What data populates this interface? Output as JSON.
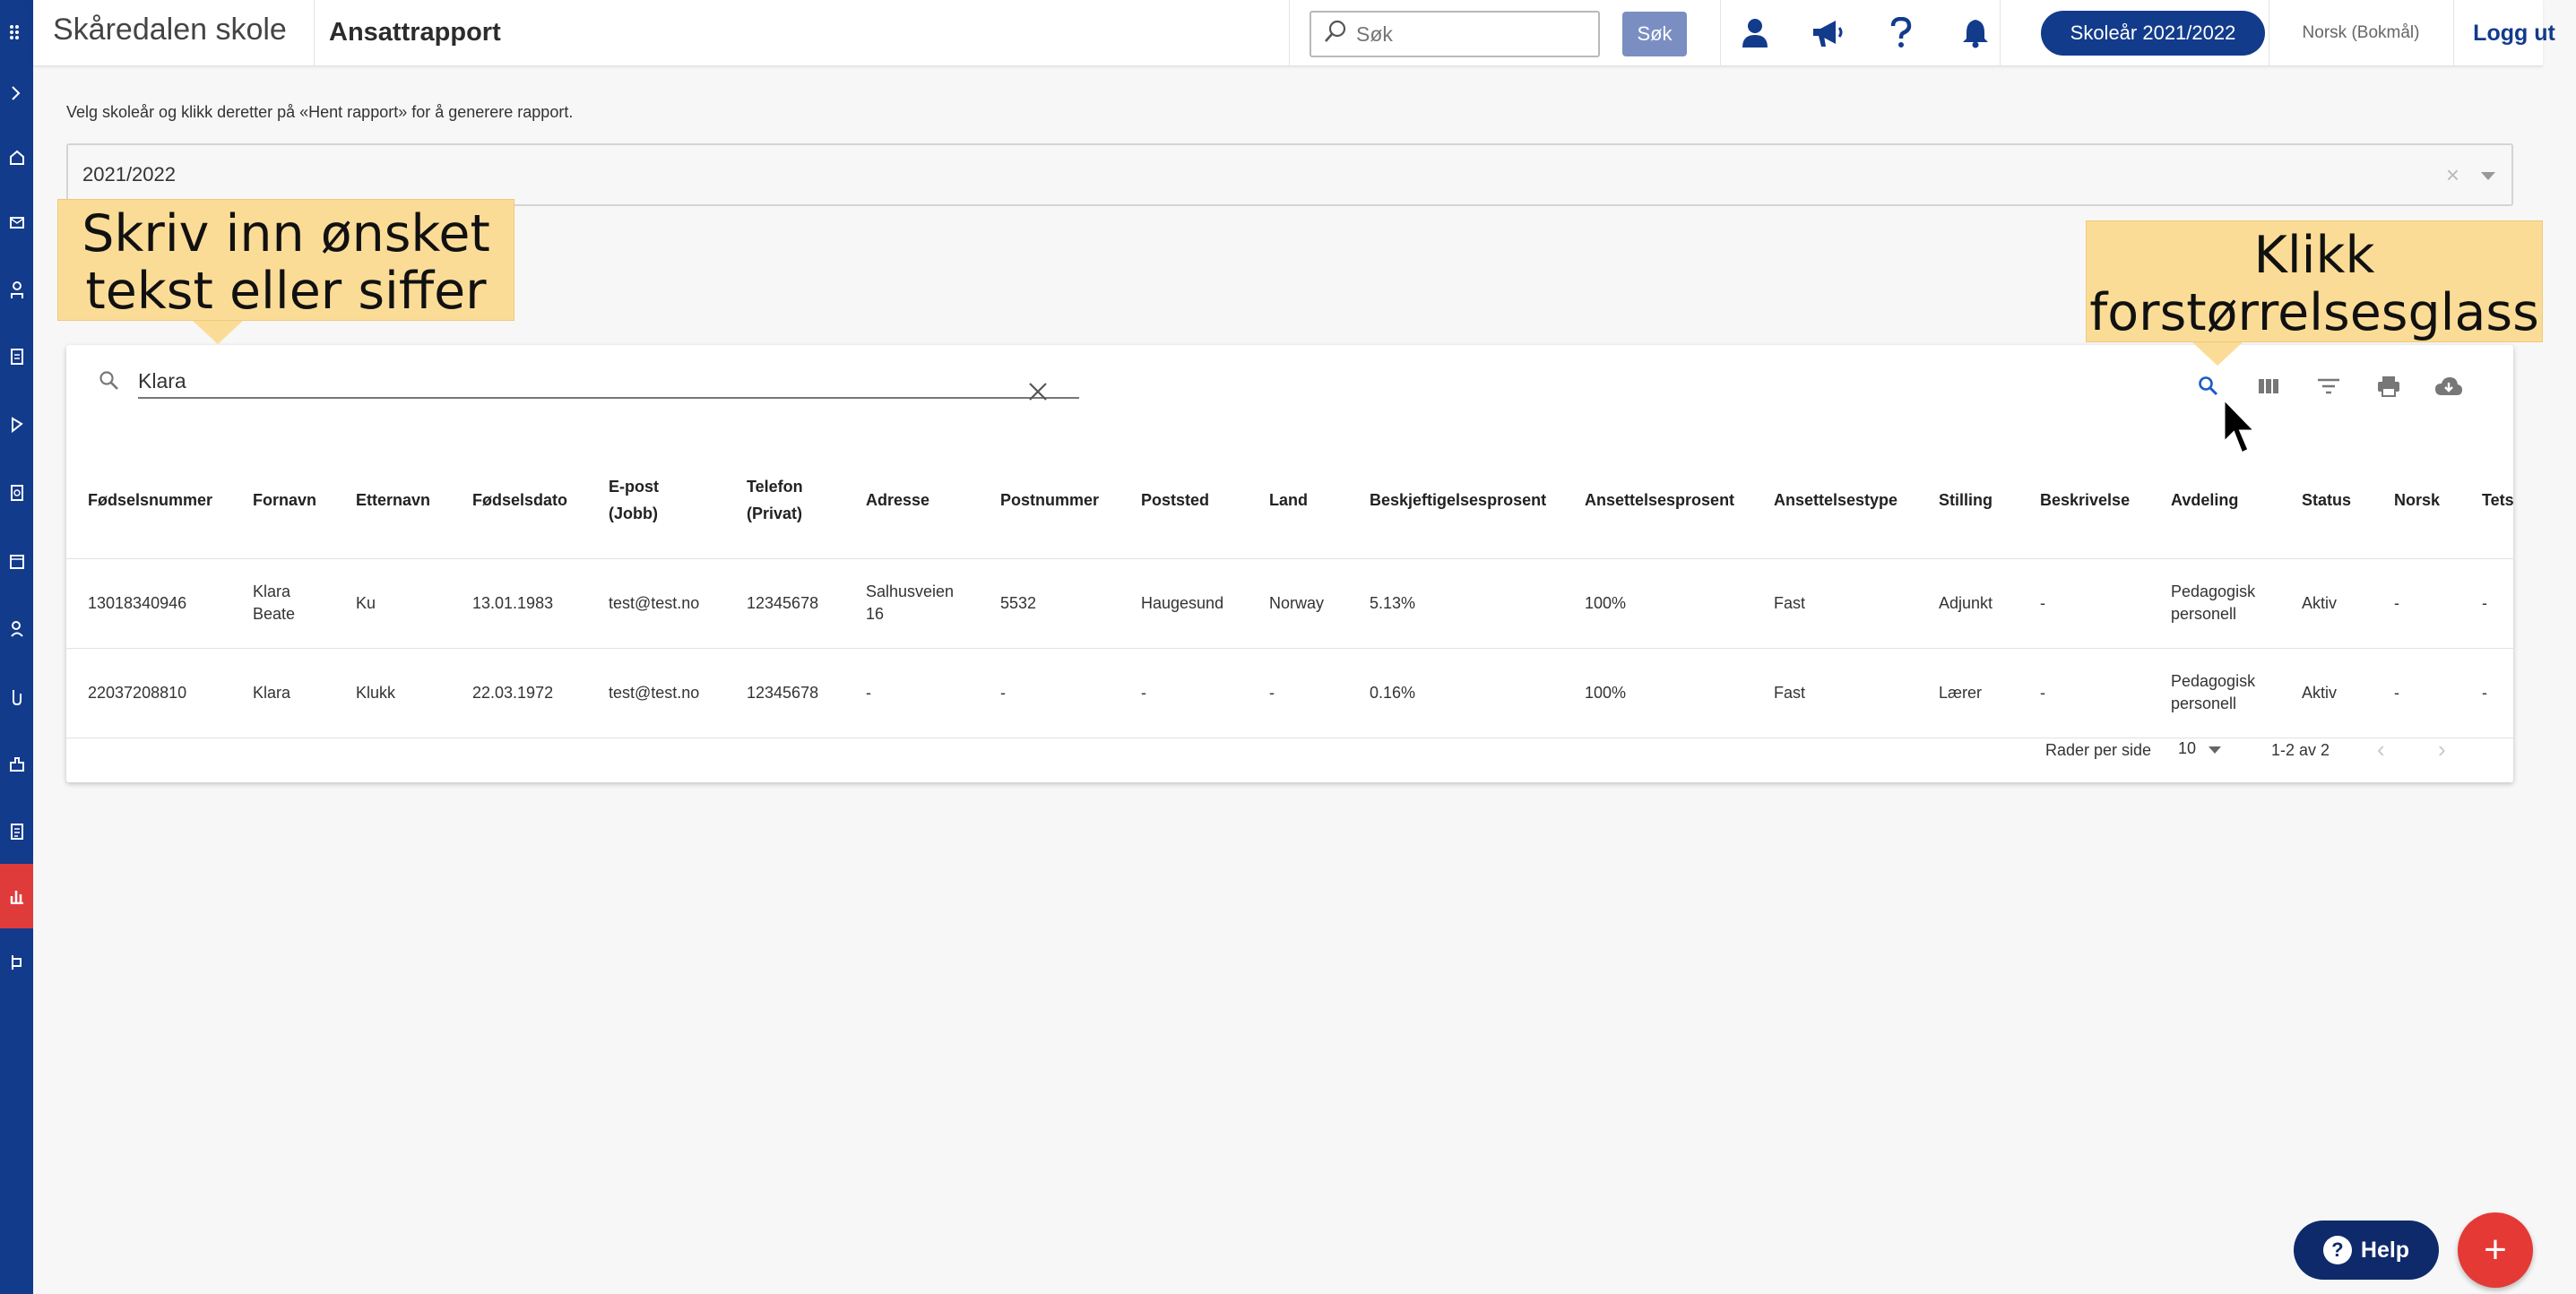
{
  "header": {
    "school_name": "Skåredalen skole",
    "page_title": "Ansattrapport",
    "search_placeholder": "Søk",
    "search_button": "Søk",
    "school_year_button": "Skoleår 2021/2022",
    "language": "Norsk (Bokmål)",
    "logout": "Logg ut",
    "icons": [
      "user-icon",
      "megaphone-icon",
      "help-icon",
      "bell-icon"
    ]
  },
  "sidebar": {
    "icons": [
      "apps-icon",
      "chevron-right-icon",
      "home-icon",
      "mail-icon",
      "students-icon",
      "document-icon",
      "timetable-icon",
      "assessment-icon",
      "calendar-icon",
      "users-icon",
      "absence-icon",
      "school-icon",
      "reports-icon",
      "statistics-icon",
      "settings-icon"
    ],
    "active": "statistics-icon",
    "active_color": "#e03b3b",
    "color": "#123b8c"
  },
  "content": {
    "instruction": "Velg skoleår og klikk deretter på «Hent rapport» for å generere rapport.",
    "selected_year": "2021/2022"
  },
  "table": {
    "search_value": "Klara",
    "columns": [
      {
        "line1": "Fødselsnummer",
        "line2": ""
      },
      {
        "line1": "Fornavn",
        "line2": ""
      },
      {
        "line1": "Etternavn",
        "line2": ""
      },
      {
        "line1": "Fødselsdato",
        "line2": ""
      },
      {
        "line1": "E-post",
        "line2": "(Jobb)"
      },
      {
        "line1": "Telefon",
        "line2": "(Privat)"
      },
      {
        "line1": "Adresse",
        "line2": ""
      },
      {
        "line1": "Postnummer",
        "line2": ""
      },
      {
        "line1": "Poststed",
        "line2": ""
      },
      {
        "line1": "Land",
        "line2": ""
      },
      {
        "line1": "Beskjeftigelsesprosent",
        "line2": ""
      },
      {
        "line1": "Ansettelsesprosent",
        "line2": ""
      },
      {
        "line1": "Ansettelsestype",
        "line2": ""
      },
      {
        "line1": "Stilling",
        "line2": ""
      },
      {
        "line1": "Beskrivelse",
        "line2": ""
      },
      {
        "line1": "Avdeling",
        "line2": ""
      },
      {
        "line1": "Status",
        "line2": ""
      },
      {
        "line1": "Norsk",
        "line2": ""
      },
      {
        "line1": "Tets",
        "line2": ""
      }
    ],
    "rows": [
      [
        [
          "13018340946"
        ],
        [
          "Klara",
          "Beate"
        ],
        [
          "Ku"
        ],
        [
          "13.01.1983"
        ],
        [
          "test@test.no"
        ],
        [
          "12345678"
        ],
        [
          "Salhusveien",
          "16"
        ],
        [
          "5532"
        ],
        [
          "Haugesund"
        ],
        [
          "Norway"
        ],
        [
          "5.13%"
        ],
        [
          "100%"
        ],
        [
          "Fast"
        ],
        [
          "Adjunkt"
        ],
        [
          "-"
        ],
        [
          "Pedagogisk",
          "personell"
        ],
        [
          "Aktiv"
        ],
        [
          "-"
        ],
        [
          "-"
        ]
      ],
      [
        [
          "22037208810"
        ],
        [
          "Klara"
        ],
        [
          "Klukk"
        ],
        [
          "22.03.1972"
        ],
        [
          "test@test.no"
        ],
        [
          "12345678"
        ],
        [
          "-"
        ],
        [
          "-"
        ],
        [
          "-"
        ],
        [
          "-"
        ],
        [
          "0.16%"
        ],
        [
          "100%"
        ],
        [
          "Fast"
        ],
        [
          "Lærer"
        ],
        [
          "-"
        ],
        [
          "Pedagogisk",
          "personell"
        ],
        [
          "Aktiv"
        ],
        [
          "-"
        ],
        [
          "-"
        ]
      ]
    ],
    "rows_per_page_label": "Rader per side",
    "rows_per_page": "10",
    "range": "1-2 av 2",
    "toolbar_icons": [
      "search-icon",
      "columns-icon",
      "filter-icon",
      "print-icon",
      "download-icon"
    ]
  },
  "callouts": {
    "search_hint_line1": "Skriv inn ønsket",
    "search_hint_line2": "tekst eller siffer",
    "magnifier_hint_line1": "Klikk",
    "magnifier_hint_line2": "forstørrelsesglass",
    "color": "#fbdc97"
  },
  "floating": {
    "help_label": "Help",
    "add_symbol": "+"
  }
}
